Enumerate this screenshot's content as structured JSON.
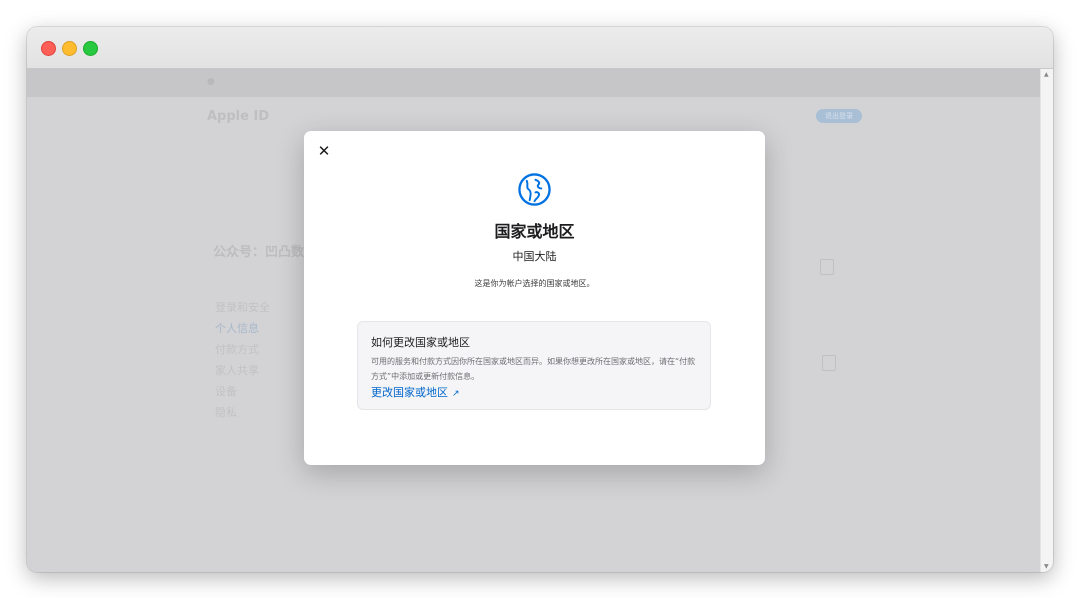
{
  "window": {
    "controls": [
      "close",
      "minimize",
      "maximize"
    ]
  },
  "background_page": {
    "nav_items": [
      "",
      "",
      "",
      "",
      "",
      "",
      "",
      "",
      "",
      "",
      "",
      "",
      ""
    ],
    "title": "Apple ID",
    "signout_button": "退出登录",
    "account_name": "公众号：凹凸数",
    "account_sub": "",
    "sidebar_items": [
      "登录和安全",
      "个人信息",
      "付款方式",
      "家人共享",
      "设备",
      "隐私"
    ],
    "sidebar_active_index": 1
  },
  "modal": {
    "close_label": "✕",
    "icon": "globe-icon",
    "title": "国家或地区",
    "country": "中国大陆",
    "description": "这是你为帐户选择的国家或地区。",
    "info": {
      "heading": "如何更改国家或地区",
      "body": "可用的服务和付款方式因你所在国家或地区而异。如果你想更改所在国家或地区，请在“付款方式”中添加或更新付款信息。",
      "link_text": "更改国家或地区",
      "link_icon": "external-arrow-icon"
    },
    "accent_color": "#0071e3",
    "link_color": "#0066cc"
  }
}
